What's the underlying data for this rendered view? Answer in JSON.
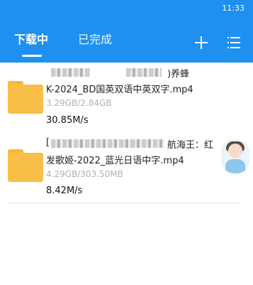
{
  "status_bar": {
    "time": "11:33"
  },
  "tabs": [
    {
      "label": "下载中",
      "active": true
    },
    {
      "label": "已完成",
      "active": false
    }
  ],
  "header": {
    "accent_color": "#1e90f0",
    "add_icon": "plus-icon",
    "menu_icon": "list-menu-icon"
  },
  "downloads": [
    {
      "title_line1_suffix": ")养蜂",
      "title_line2": "K-2024_BD国英双语中英双字.mp4",
      "progress": "3.29GB/2.84GB",
      "speed": "30.85M/s",
      "icon": "folder-icon"
    },
    {
      "title_line1_prefix": "[",
      "title_line1_suffix": "航海王：红",
      "title_line2": "发歌姬-2022_蓝光日语中字.mp4",
      "progress": "4.29GB/303.50MB",
      "speed": "8.42M/s",
      "icon": "folder-icon"
    }
  ]
}
